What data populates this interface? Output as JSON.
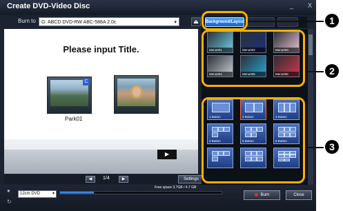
{
  "window": {
    "title": "Create DVD-Video Disc",
    "minimize_glyph": "_",
    "close_glyph": "X"
  },
  "burn": {
    "label": "Burn to",
    "drive_value": "G: ABCD DVD-RW ABC-588A 2.0c",
    "eject_icon": "eject-icon"
  },
  "tabs": {
    "active_label": "Background/Layout"
  },
  "preview": {
    "title": "Please input Title.",
    "thumb_label": "Park01",
    "page_indicator": "1/4",
    "settings_label": "Settings"
  },
  "menus": [
    {
      "label": "Menu001",
      "color": "#6fd0e6"
    },
    {
      "label": "Menu002",
      "color": "#1a2f7a"
    },
    {
      "label": "Menu003",
      "color": "#e8c3cf"
    },
    {
      "label": "Menu004",
      "color": "#c8cfd8"
    },
    {
      "label": "Menu005",
      "color": "#2aa3d8"
    },
    {
      "label": "Menu006",
      "color": "#d3334c"
    }
  ],
  "layouts": [
    {
      "label": "1 Button",
      "boxes": 1,
      "selected": false
    },
    {
      "label": "2 Button",
      "boxes": 2,
      "selected": true
    },
    {
      "label": "3 Button",
      "boxes": 3,
      "selected": false
    },
    {
      "label": "4 Button",
      "boxes": 4,
      "selected": false
    },
    {
      "label": "5 Button",
      "boxes": 5,
      "selected": false
    },
    {
      "label": "6 Button",
      "boxes": 6,
      "selected": false
    },
    {
      "label": "",
      "boxes": 4,
      "selected": false
    },
    {
      "label": "",
      "boxes": 6,
      "selected": false
    },
    {
      "label": "",
      "boxes": 8,
      "selected": false
    }
  ],
  "footer": {
    "media_type": "12cm DVD",
    "free_space": "Free space 3.7GB / 4.7 GB",
    "capacity_used": 0.21,
    "burn_label": "Burn",
    "close_label": "Close"
  },
  "callouts": [
    "1",
    "2",
    "3"
  ],
  "colors": {
    "accent_ring": "#ffb000",
    "tab_active": "#1a5fc8",
    "burn_dot": "#e52b2b"
  }
}
